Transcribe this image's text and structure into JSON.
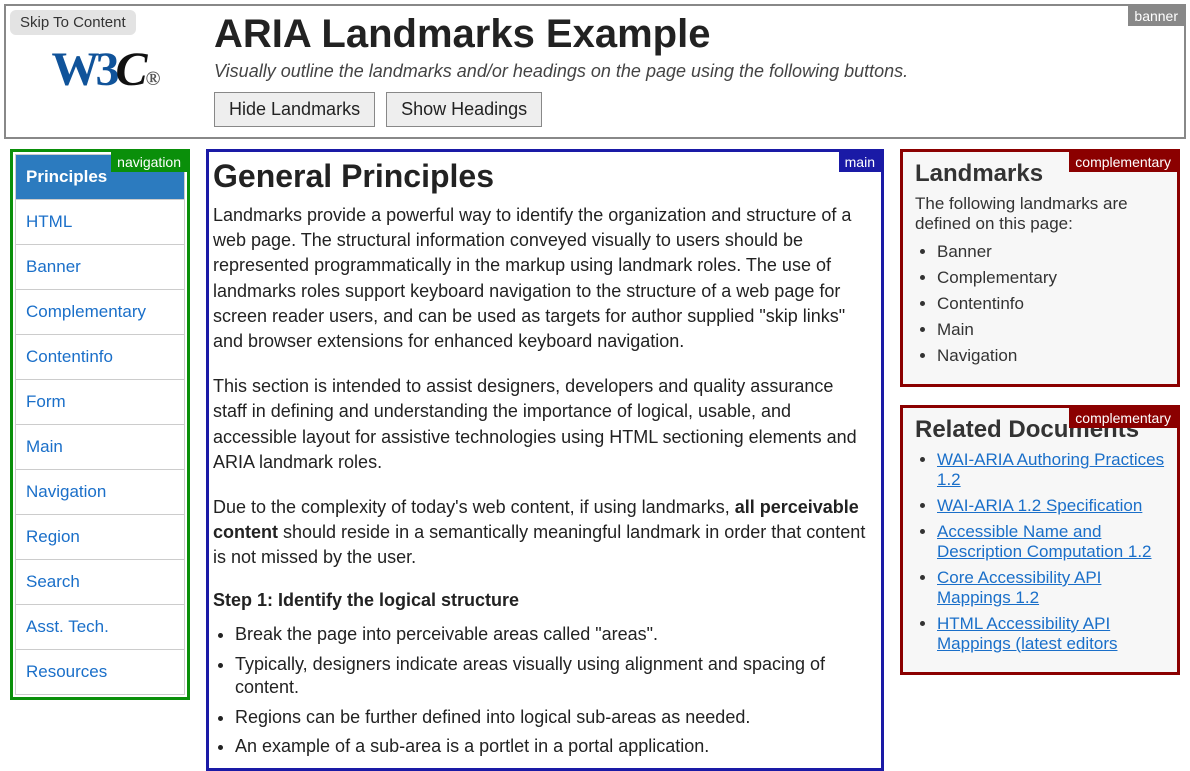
{
  "banner": {
    "skip_label": "Skip To Content",
    "title": "ARIA Landmarks Example",
    "subtitle": "Visually outline the landmarks and/or headings on the page using the following buttons.",
    "hide_btn": "Hide Landmarks",
    "show_btn": "Show Headings",
    "label": "banner"
  },
  "nav": {
    "label": "navigation",
    "items": [
      {
        "label": "Principles",
        "active": true
      },
      {
        "label": "HTML"
      },
      {
        "label": "Banner"
      },
      {
        "label": "Complementary"
      },
      {
        "label": "Contentinfo"
      },
      {
        "label": "Form"
      },
      {
        "label": "Main"
      },
      {
        "label": "Navigation"
      },
      {
        "label": "Region"
      },
      {
        "label": "Search"
      },
      {
        "label": "Asst. Tech."
      },
      {
        "label": "Resources"
      }
    ]
  },
  "main": {
    "label": "main",
    "heading": "General Principles",
    "p1": "Landmarks provide a powerful way to identify the organization and structure of a web page. The structural information conveyed visually to users should be represented programmatically in the markup using landmark roles. The use of landmarks roles support keyboard navigation to the structure of a web page for screen reader users, and can be used as targets for author supplied \"skip links\" and browser extensions for enhanced keyboard navigation.",
    "p2": "This section is intended to assist designers, developers and quality assurance staff in defining and understanding the importance of logical, usable, and accessible layout for assistive technologies using HTML sectioning elements and ARIA landmark roles.",
    "p3_pre": "Due to the complexity of today's web content, if using landmarks, ",
    "p3_strong": "all perceivable content",
    "p3_post": " should reside in a semantically meaningful landmark in order that content is not missed by the user.",
    "step_heading": "Step 1: Identify the logical structure",
    "steps": [
      "Break the page into perceivable areas called \"areas\".",
      "Typically, designers indicate areas visually using alignment and spacing of content.",
      "Regions can be further defined into logical sub-areas as needed.",
      "An example of a sub-area is a portlet in a portal application."
    ]
  },
  "aside1": {
    "label": "complementary",
    "heading": "Landmarks",
    "intro": "The following landmarks are defined on this page:",
    "items": [
      "Banner",
      "Complementary",
      "Contentinfo",
      "Main",
      "Navigation"
    ]
  },
  "aside2": {
    "label": "complementary",
    "heading": "Related Documents",
    "items": [
      "WAI-ARIA Authoring Practices 1.2",
      "WAI-ARIA 1.2 Specification",
      "Accessible Name and Description Computation 1.2",
      "Core Accessibility API Mappings 1.2",
      "HTML Accessibility API Mappings (latest editors"
    ]
  }
}
